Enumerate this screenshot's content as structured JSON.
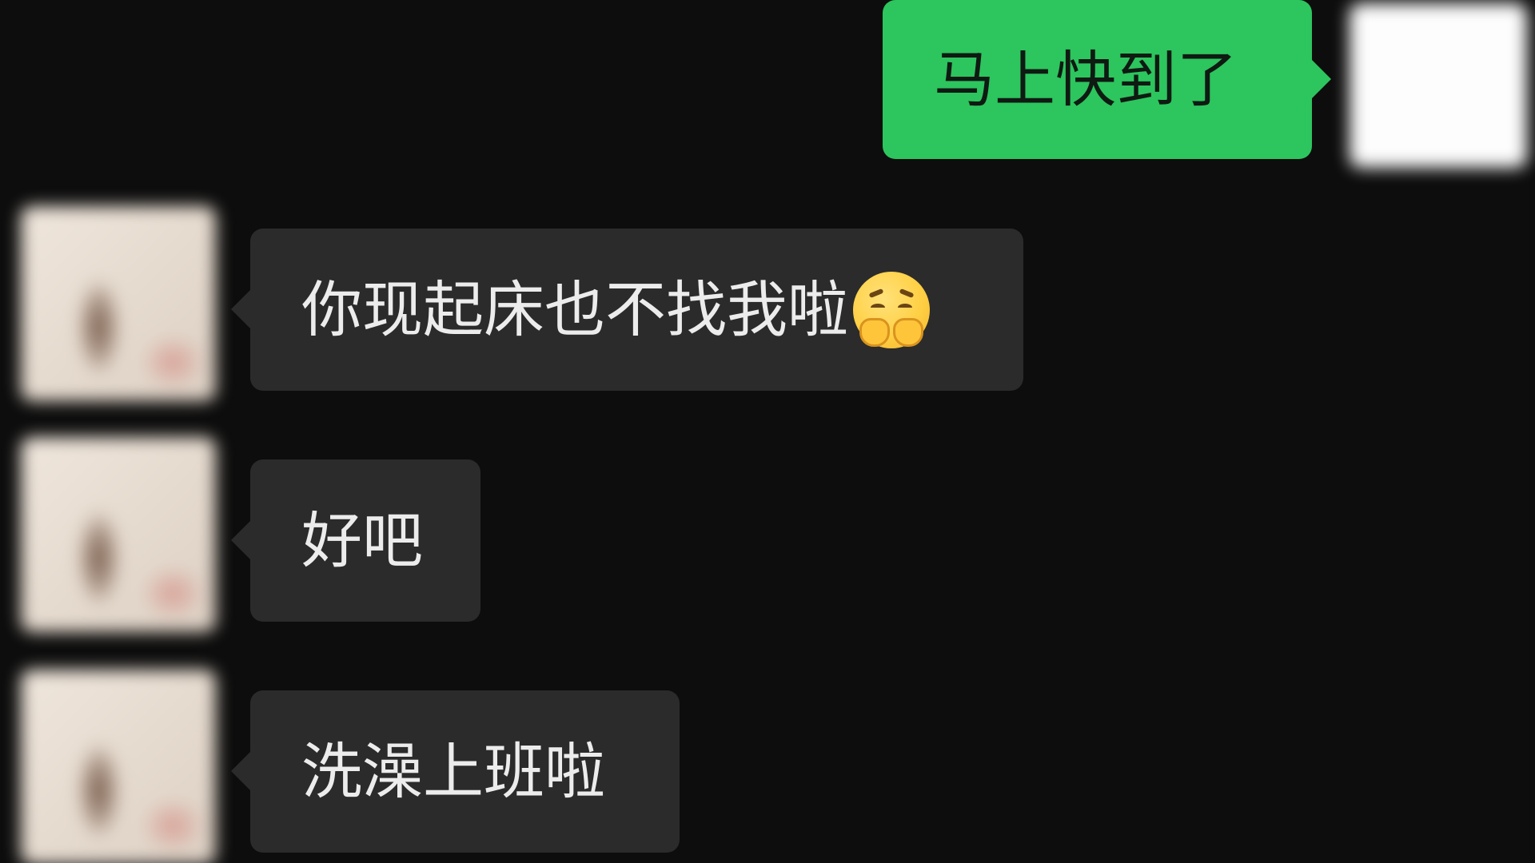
{
  "chat": {
    "messages": [
      {
        "direction": "outgoing",
        "text": "马上快到了"
      },
      {
        "direction": "incoming",
        "text": "你现起床也不找我啦",
        "emoji": "face-with-hand-over-mouth-worried"
      },
      {
        "direction": "incoming",
        "text": "好吧"
      },
      {
        "direction": "incoming",
        "text": "洗澡上班啦"
      }
    ]
  },
  "colors": {
    "background": "#0d0d0d",
    "outgoing_bubble": "#2dc55e",
    "incoming_bubble": "#2b2b2b",
    "incoming_text": "#ececec",
    "outgoing_text": "#0e1a12"
  }
}
